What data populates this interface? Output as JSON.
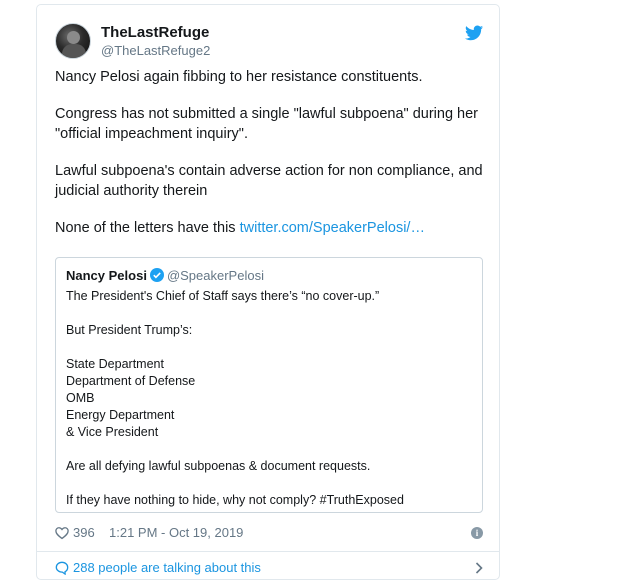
{
  "author": {
    "name": "TheLastRefuge",
    "handle": "@TheLastRefuge2"
  },
  "tweet": {
    "paragraphs": [
      "Nancy Pelosi again fibbing to her resistance constituents.",
      "Congress has not submitted a single \"lawful subpoena\" during her \"official impeachment inquiry\".",
      "Lawful subpoena's contain adverse action for non compliance, and judicial authority therein"
    ],
    "last_line_text": "None of the letters have this",
    "link_text": "twitter.com/SpeakerPelosi/…"
  },
  "quoted": {
    "name": "Nancy Pelosi",
    "handle": "@SpeakerPelosi",
    "line1": "The President's Chief of Staff says there’s “no cover-up.”",
    "line2": "But President Trump’s:",
    "list": [
      "State Department",
      "Department of Defense",
      "OMB",
      "Energy Department",
      "& Vice President"
    ],
    "line3": "Are all defying lawful subpoenas & document requests.",
    "line4": "If they have nothing to hide, why not comply? #TruthExposed"
  },
  "meta": {
    "likes": "396",
    "timestamp": "1:21 PM - Oct 19, 2019"
  },
  "footer": {
    "talking": "288 people are talking about this"
  },
  "colors": {
    "link": "#1b95e0",
    "muted": "#657786",
    "border": "#e1e8ed"
  },
  "icons": [
    "twitter-bird-icon",
    "verified-icon",
    "heart-icon",
    "info-icon",
    "chat-bubble-icon",
    "chevron-right-icon"
  ]
}
